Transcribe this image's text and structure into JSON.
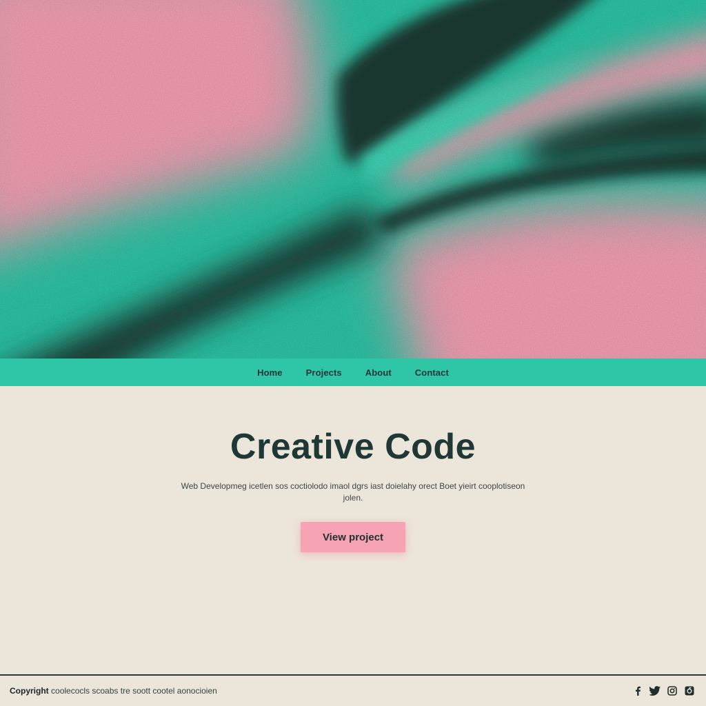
{
  "nav": {
    "items": [
      {
        "label": "Home"
      },
      {
        "label": "Projects"
      },
      {
        "label": "About"
      },
      {
        "label": "Contact"
      }
    ]
  },
  "hero": {
    "title": "Creative Code",
    "description": "Web Developmeg icetlen sos coctiolodo imaol dgrs iast doielahy orect Boet yieirt cooplotiseon jolen.",
    "cta_label": "View project"
  },
  "footer": {
    "copyright_prefix": "Copyright",
    "copyright_text": "coolecocls scoabs tre soott cootel aonocioien",
    "socials": [
      {
        "icon": "facebook-icon"
      },
      {
        "icon": "twitter-icon"
      },
      {
        "icon": "instagram-icon"
      },
      {
        "icon": "other-social-icon"
      }
    ]
  },
  "colors": {
    "pink": "#f7a3b6",
    "teal": "#2fc6a8",
    "dark": "#1f3735",
    "cream": "#ece5d9"
  }
}
